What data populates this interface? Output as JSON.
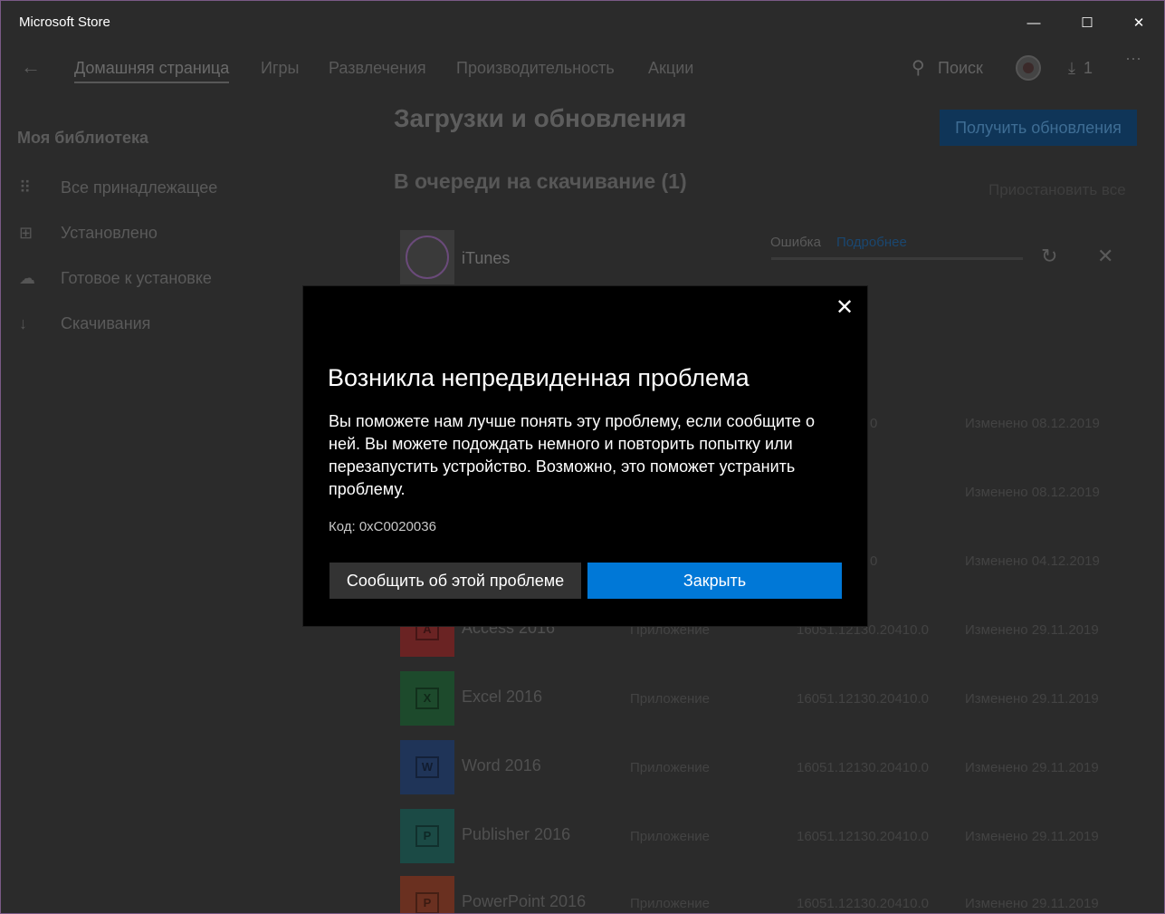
{
  "window": {
    "title": "Microsoft Store",
    "minimize": "—",
    "maximize": "☐",
    "close": "✕"
  },
  "nav": {
    "back": "←",
    "tabs": [
      {
        "label": "Домашняя страница",
        "active": true
      },
      {
        "label": "Игры"
      },
      {
        "label": "Развлечения"
      },
      {
        "label": "Производительность"
      },
      {
        "label": "Акции"
      }
    ],
    "search_icon": "⚲",
    "search_label": "Поиск",
    "downloads_icon": "⤓",
    "downloads_count": "1",
    "more": "⋯"
  },
  "sidebar": {
    "title": "Моя библиотека",
    "items": [
      {
        "icon": "grid-icon",
        "glyph": "⠿",
        "label": "Все принадлежащее"
      },
      {
        "icon": "installed-icon",
        "glyph": "⊞",
        "label": "Установлено"
      },
      {
        "icon": "cloud-icon",
        "glyph": "☁",
        "label": "Готовое к установке"
      },
      {
        "icon": "download-icon",
        "glyph": "↓",
        "label": "Скачивания"
      }
    ]
  },
  "main": {
    "title": "Загрузки и обновления",
    "update_button": "Получить обновления",
    "queue_title": "В очереди на скачивание (1)",
    "pause_all": "Приостановить все",
    "queue_item": {
      "name": "iTunes",
      "status": "Ошибка",
      "details": "Подробнее",
      "retry": "↻",
      "cancel": "✕"
    },
    "recent": [
      {
        "date": "Изменено 08.12.2019",
        "ver_tail": "0"
      },
      {
        "date": "Изменено 08.12.2019"
      },
      {
        "date": "Изменено 04.12.2019",
        "ver_tail": "0"
      },
      {
        "name": "Access 2016",
        "type": "Приложение",
        "version": "16051.12130.20410.0",
        "date": "Изменено 29.11.2019",
        "color": "#6a2323",
        "letter": "A"
      },
      {
        "name": "Excel 2016",
        "type": "Приложение",
        "version": "16051.12130.20410.0",
        "date": "Изменено 29.11.2019",
        "color": "#1d4a2c",
        "letter": "X"
      },
      {
        "name": "Word 2016",
        "type": "Приложение",
        "version": "16051.12130.20410.0",
        "date": "Изменено 29.11.2019",
        "color": "#1f3458",
        "letter": "W"
      },
      {
        "name": "Publisher 2016",
        "type": "Приложение",
        "version": "16051.12130.20410.0",
        "date": "Изменено 29.11.2019",
        "color": "#1b4a45",
        "letter": "P"
      },
      {
        "name": "PowerPoint 2016",
        "type": "Приложение",
        "version": "16051.12130.20410.0",
        "date": "Изменено 29.11.2019",
        "color": "#6a3020",
        "letter": "P"
      }
    ]
  },
  "dialog": {
    "close": "✕",
    "title": "Возникла непредвиденная проблема",
    "body": "Вы поможете нам лучше понять эту проблему, если сообщите о ней. Вы можете подождать немного и повторить попытку или перезапустить устройство. Возможно, это поможет устранить проблему.",
    "code": "Код: 0xC0020036",
    "report_button": "Сообщить об этой проблеме",
    "close_button": "Закрыть"
  }
}
